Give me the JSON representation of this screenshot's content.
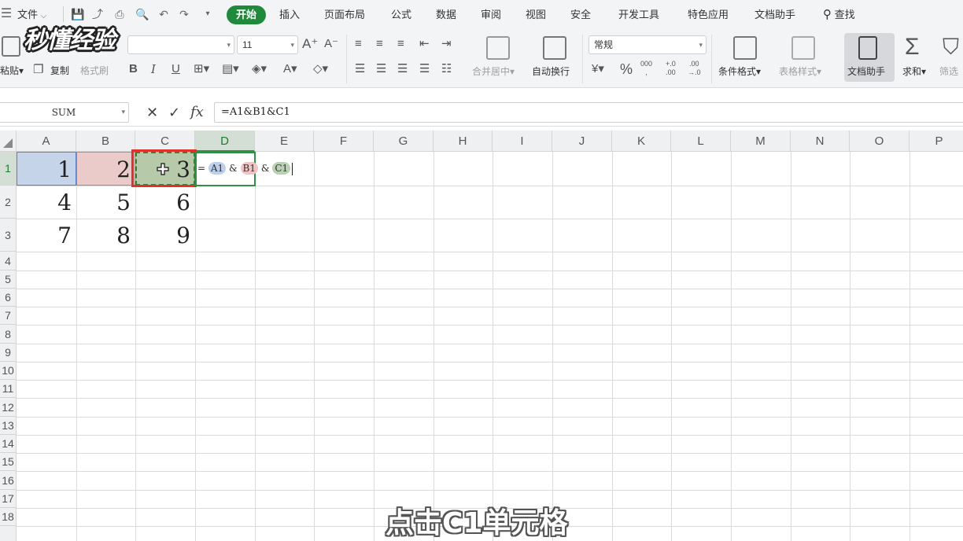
{
  "app": {
    "logo_text": "秒懂经验"
  },
  "menubar": {
    "file_label": "文件",
    "tabs": [
      "开始",
      "插入",
      "页面布局",
      "公式",
      "数据",
      "审阅",
      "视图",
      "安全",
      "开发工具",
      "特色应用",
      "文档助手"
    ],
    "active_tab": "开始",
    "search_label": "查找"
  },
  "ribbon": {
    "paste_label": "粘贴",
    "copy_label": "复制",
    "format_painter_label": "格式刷",
    "font_name": "",
    "font_size": "11",
    "merge_center_label": "合并居中",
    "wrap_text_label": "自动换行",
    "number_format": "常规",
    "conditional_format_label": "条件格式",
    "table_style_label": "表格样式",
    "doc_assistant_label": "文档助手",
    "sum_label": "求和",
    "filter_label": "筛选"
  },
  "formula_bar": {
    "name_box": "SUM",
    "formula": "=A1&B1&C1"
  },
  "sheet": {
    "columns": [
      "A",
      "B",
      "C",
      "D",
      "E",
      "F",
      "G",
      "H",
      "I",
      "J",
      "K",
      "L",
      "M",
      "N",
      "O",
      "P"
    ],
    "rows": [
      "1",
      "2",
      "3",
      "4",
      "5",
      "6",
      "7",
      "8",
      "9",
      "10",
      "11",
      "12",
      "13",
      "14",
      "15",
      "16",
      "17",
      "18"
    ],
    "cells": [
      [
        "1",
        "2",
        "3"
      ],
      [
        "4",
        "5",
        "6"
      ],
      [
        "7",
        "8",
        "9"
      ]
    ],
    "editing": {
      "eq": "=",
      "ref_a": "A1",
      "amp1": "&",
      "ref_b": "B1",
      "amp2": "&",
      "ref_c": "C1"
    }
  },
  "subtitle": "点击C1单元格",
  "colors": {
    "active_tab_green": "#1f8a3b",
    "ref_a_blue": "#c6d4ea",
    "ref_b_red": "#ebcaca",
    "ref_c_green": "#b6c9a8",
    "click_frame_red": "#e0312b"
  }
}
